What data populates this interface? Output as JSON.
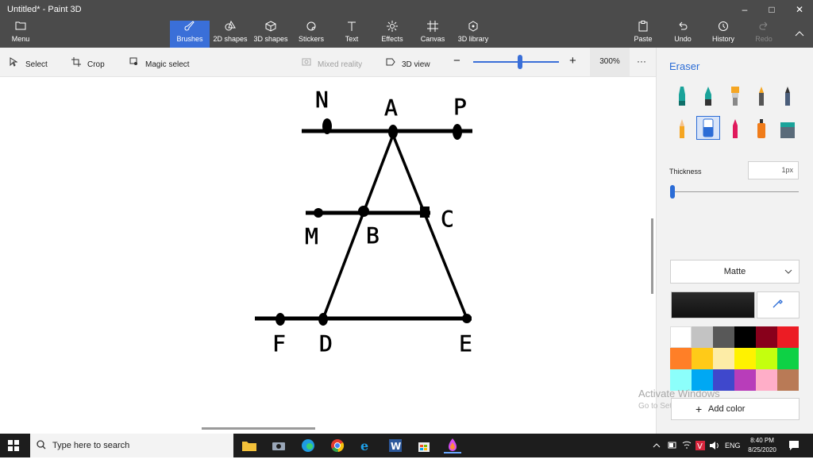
{
  "window": {
    "title": "Untitled* - Paint 3D",
    "controls": {
      "minimize": "–",
      "maximize": "□",
      "close": "✕"
    }
  },
  "ribbon": {
    "menu_label": "Menu",
    "tabs": [
      {
        "label": "Brushes",
        "icon": "brush-icon"
      },
      {
        "label": "2D shapes",
        "icon": "2d-shapes-icon"
      },
      {
        "label": "3D shapes",
        "icon": "3d-shapes-icon"
      },
      {
        "label": "Stickers",
        "icon": "stickers-icon"
      },
      {
        "label": "Text",
        "icon": "text-icon"
      },
      {
        "label": "Effects",
        "icon": "effects-icon"
      },
      {
        "label": "Canvas",
        "icon": "canvas-icon"
      },
      {
        "label": "3D library",
        "icon": "3d-library-icon"
      }
    ],
    "active_tab": "Brushes",
    "right": [
      {
        "label": "Paste",
        "icon": "paste-icon"
      },
      {
        "label": "Undo",
        "icon": "undo-icon"
      },
      {
        "label": "History",
        "icon": "history-icon"
      },
      {
        "label": "Redo",
        "icon": "redo-icon"
      }
    ]
  },
  "toolbar": {
    "select": "Select",
    "crop": "Crop",
    "magic_select": "Magic select",
    "mixed_reality": "Mixed reality",
    "view_3d": "3D view",
    "zoom_minus": "−",
    "zoom_plus": "+",
    "zoom_value": "300%",
    "zoom_level": 0.55,
    "more": "···"
  },
  "drawing": {
    "labels": [
      "N",
      "A",
      "P",
      "C",
      "M",
      "B",
      "F",
      "D",
      "E"
    ]
  },
  "panel": {
    "title": "Eraser",
    "brushes": [
      "marker-icon",
      "calligraphy-pen-icon",
      "oil-brush-icon",
      "watercolor-icon",
      "pixel-pen-icon",
      "pencil-icon",
      "eraser-icon",
      "crayon-icon",
      "spray-can-icon",
      "fill-icon"
    ],
    "selected_brush": "eraser-icon",
    "thickness_label": "Thickness",
    "thickness_value": "1px",
    "thickness_level": 0.0,
    "finish": "Matte",
    "current_color": "#1a1a1a",
    "palette": [
      "#ffffff",
      "#c3c3c3",
      "#585858",
      "#000000",
      "#88001b",
      "#ec1c24",
      "#ff7f27",
      "#ffca18",
      "#fdeca6",
      "#fff200",
      "#c4ff0e",
      "#0ed145",
      "#8cfffb",
      "#00a8f3",
      "#3f48cc",
      "#b83dba",
      "#ffaec8",
      "#b97a56"
    ],
    "add_color": "Add color"
  },
  "watermark": {
    "line1": "Activate Windows",
    "line2": "Go to Settings to activate Windows."
  },
  "taskbar": {
    "search_placeholder": "Type here to search",
    "language": "ENG",
    "time": "8:40 PM",
    "date": "8/25/2020"
  }
}
